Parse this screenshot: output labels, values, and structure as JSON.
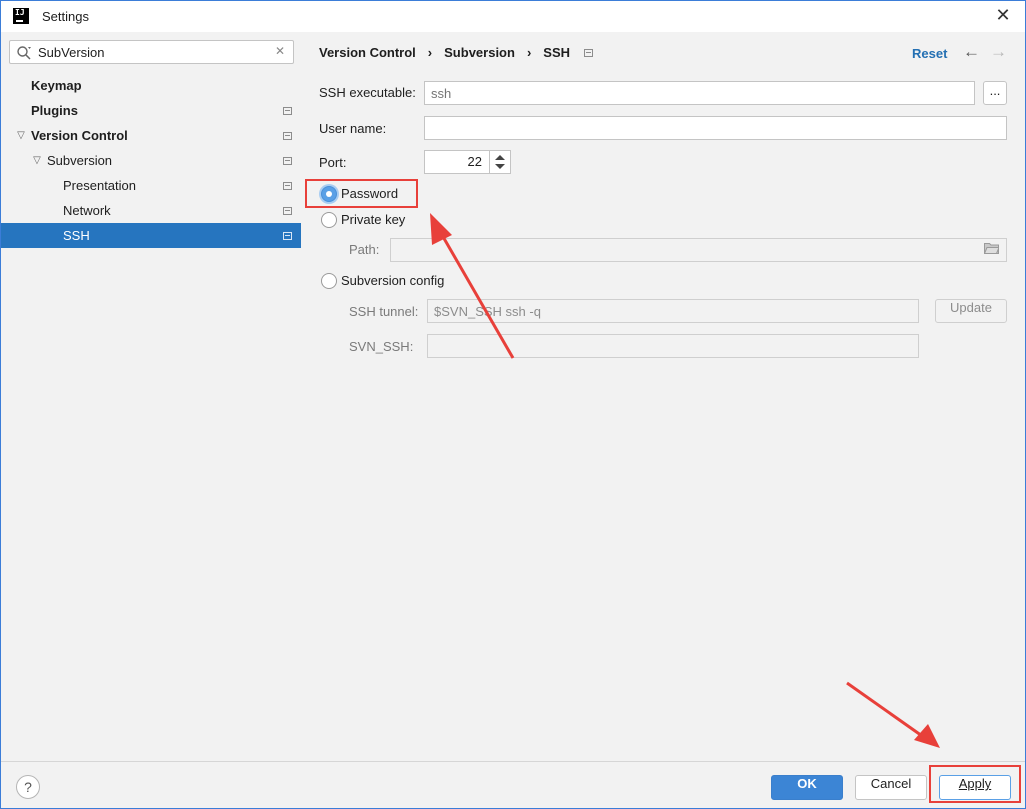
{
  "window": {
    "title": "Settings",
    "app_icon": "IJ"
  },
  "search": {
    "value": "SubVersion"
  },
  "tree": [
    {
      "label": "Keymap",
      "bold": true
    },
    {
      "label": "Plugins",
      "bold": true
    },
    {
      "label": "Version Control",
      "bold": true,
      "expanded": true
    },
    {
      "label": "Subversion",
      "bold": false,
      "expanded": true
    },
    {
      "label": "Presentation",
      "bold": false
    },
    {
      "label": "Network",
      "bold": false
    },
    {
      "label": "SSH",
      "bold": false,
      "selected": true
    }
  ],
  "breadcrumb": {
    "items": [
      "Version Control",
      "Subversion",
      "SSH"
    ]
  },
  "header": {
    "reset_label": "Reset"
  },
  "ssh_form": {
    "ssh_executable_label": "SSH executable:",
    "ssh_executable_placeholder": "ssh",
    "browse_label": "...",
    "user_name_label": "User name:",
    "user_name_value": "",
    "port_label": "Port:",
    "port_value": "22",
    "auth_password_label": "Password",
    "auth_private_key_label": "Private key",
    "path_label": "Path:",
    "path_value": "",
    "auth_subversion_config_label": "Subversion config",
    "ssh_tunnel_label": "SSH tunnel:",
    "ssh_tunnel_value": "$SVN_SSH ssh -q",
    "update_label": "Update",
    "svn_ssh_label": "SVN_SSH:",
    "svn_ssh_value": "",
    "selected_auth": "Password"
  },
  "footer": {
    "help_label": "?",
    "ok_label": "OK",
    "cancel_label": "Cancel",
    "apply_label": "Apply"
  },
  "colors": {
    "selection": "#2675bf",
    "primary_button": "#3c85d5",
    "link": "#2470b3",
    "annotation": "#e8403a"
  }
}
